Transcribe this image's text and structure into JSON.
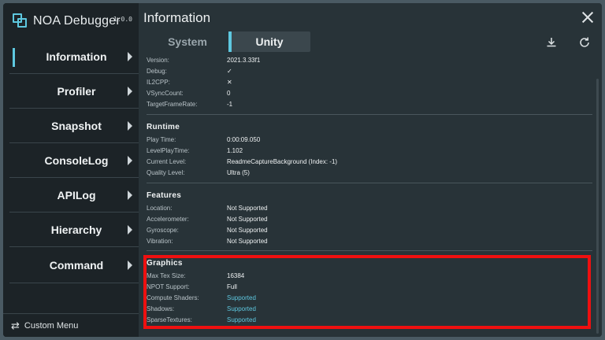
{
  "brand": {
    "title": "NOA Debugger",
    "version": "1.0.0"
  },
  "nav": [
    {
      "label": "Information"
    },
    {
      "label": "Profiler"
    },
    {
      "label": "Snapshot"
    },
    {
      "label": "ConsoleLog"
    },
    {
      "label": "APILog"
    },
    {
      "label": "Hierarchy"
    },
    {
      "label": "Command"
    }
  ],
  "custom_menu": {
    "label": "Custom Menu",
    "icon": "swap-arrows-icon"
  },
  "header": {
    "title": "Information"
  },
  "tabs": [
    {
      "label": "System"
    },
    {
      "label": "Unity"
    }
  ],
  "app_info": {
    "rows": [
      {
        "key": "Version:",
        "value": "2021.3.33f1"
      },
      {
        "key": "Debug:",
        "value": "✓"
      },
      {
        "key": "IL2CPP:",
        "value": "✕"
      },
      {
        "key": "VSyncCount:",
        "value": "0"
      },
      {
        "key": "TargetFrameRate:",
        "value": "-1"
      }
    ]
  },
  "runtime": {
    "title": "Runtime",
    "rows": [
      {
        "key": "Play Time:",
        "value": "0:00:09.050"
      },
      {
        "key": "LevelPlayTime:",
        "value": "1.102"
      },
      {
        "key": "Current Level:",
        "value": "ReadmeCaptureBackground (Index: -1)"
      },
      {
        "key": "Quality Level:",
        "value": "Ultra (5)"
      }
    ]
  },
  "features": {
    "title": "Features",
    "rows": [
      {
        "key": "Location:",
        "value": "Not Supported"
      },
      {
        "key": "Accelerometer:",
        "value": "Not Supported"
      },
      {
        "key": "Gyroscope:",
        "value": "Not Supported"
      },
      {
        "key": "Vibration:",
        "value": "Not Supported"
      }
    ]
  },
  "graphics": {
    "title": "Graphics",
    "rows": [
      {
        "key": "Max Tex Size:",
        "value": "16384"
      },
      {
        "key": "NPOT Support:",
        "value": "Full"
      },
      {
        "key": "Compute Shaders:",
        "value": "Supported"
      },
      {
        "key": "Shadows:",
        "value": "Supported"
      },
      {
        "key": "SparseTextures:",
        "value": "Supported"
      }
    ]
  },
  "colors": {
    "accent": "#5ec8e0",
    "highlight": "#ef1010",
    "sidebar": "#1c2327",
    "panel": "#283338"
  }
}
